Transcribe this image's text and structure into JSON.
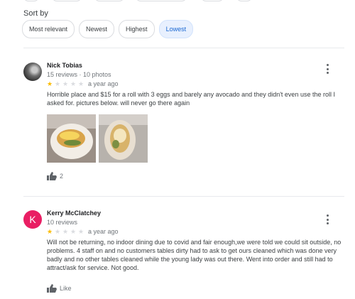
{
  "sort": {
    "label": "Sort by",
    "options": [
      "Most relevant",
      "Newest",
      "Highest",
      "Lowest"
    ],
    "selected": "Lowest"
  },
  "reviews": [
    {
      "name": "Nick Tobias",
      "meta": "15 reviews · 10 photos",
      "rating": 1,
      "date": "a year ago",
      "text": "Horrible place and $15 for a roll with 3 eggs and barely any avocado and they didn't even use the roll I asked for. pictures below. will never go there again",
      "likes": "2",
      "avatar_icon": "photo-avatar"
    },
    {
      "name": "Kerry McClatchey",
      "meta": "10 reviews",
      "rating": 1,
      "date": "a year ago",
      "text": "Will not be returning, no indoor dining due to covid and fair enough,we were told we could sit outside, no problems. 4 staff on and no customers tables dirty had to ask to get ours cleaned which was done very badly and no other tables cleaned while the young lady was out there. Went into order and still had to attract/ask for service. Not good.",
      "likes": "Like",
      "avatar_letter": "K",
      "avatar_color": "#e91e63"
    }
  ],
  "colors": {
    "star": "#fbbc04",
    "chip_active_bg": "#e8f0fe",
    "chip_active_text": "#1967d2"
  }
}
